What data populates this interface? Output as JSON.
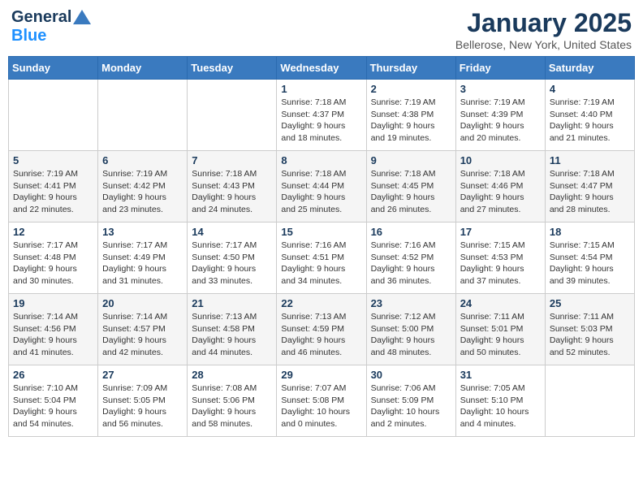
{
  "header": {
    "logo_general": "General",
    "logo_blue": "Blue",
    "month_title": "January 2025",
    "location": "Bellerose, New York, United States"
  },
  "weekdays": [
    "Sunday",
    "Monday",
    "Tuesday",
    "Wednesday",
    "Thursday",
    "Friday",
    "Saturday"
  ],
  "weeks": [
    [
      {
        "day": "",
        "info": ""
      },
      {
        "day": "",
        "info": ""
      },
      {
        "day": "",
        "info": ""
      },
      {
        "day": "1",
        "info": "Sunrise: 7:18 AM\nSunset: 4:37 PM\nDaylight: 9 hours\nand 18 minutes."
      },
      {
        "day": "2",
        "info": "Sunrise: 7:19 AM\nSunset: 4:38 PM\nDaylight: 9 hours\nand 19 minutes."
      },
      {
        "day": "3",
        "info": "Sunrise: 7:19 AM\nSunset: 4:39 PM\nDaylight: 9 hours\nand 20 minutes."
      },
      {
        "day": "4",
        "info": "Sunrise: 7:19 AM\nSunset: 4:40 PM\nDaylight: 9 hours\nand 21 minutes."
      }
    ],
    [
      {
        "day": "5",
        "info": "Sunrise: 7:19 AM\nSunset: 4:41 PM\nDaylight: 9 hours\nand 22 minutes."
      },
      {
        "day": "6",
        "info": "Sunrise: 7:19 AM\nSunset: 4:42 PM\nDaylight: 9 hours\nand 23 minutes."
      },
      {
        "day": "7",
        "info": "Sunrise: 7:18 AM\nSunset: 4:43 PM\nDaylight: 9 hours\nand 24 minutes."
      },
      {
        "day": "8",
        "info": "Sunrise: 7:18 AM\nSunset: 4:44 PM\nDaylight: 9 hours\nand 25 minutes."
      },
      {
        "day": "9",
        "info": "Sunrise: 7:18 AM\nSunset: 4:45 PM\nDaylight: 9 hours\nand 26 minutes."
      },
      {
        "day": "10",
        "info": "Sunrise: 7:18 AM\nSunset: 4:46 PM\nDaylight: 9 hours\nand 27 minutes."
      },
      {
        "day": "11",
        "info": "Sunrise: 7:18 AM\nSunset: 4:47 PM\nDaylight: 9 hours\nand 28 minutes."
      }
    ],
    [
      {
        "day": "12",
        "info": "Sunrise: 7:17 AM\nSunset: 4:48 PM\nDaylight: 9 hours\nand 30 minutes."
      },
      {
        "day": "13",
        "info": "Sunrise: 7:17 AM\nSunset: 4:49 PM\nDaylight: 9 hours\nand 31 minutes."
      },
      {
        "day": "14",
        "info": "Sunrise: 7:17 AM\nSunset: 4:50 PM\nDaylight: 9 hours\nand 33 minutes."
      },
      {
        "day": "15",
        "info": "Sunrise: 7:16 AM\nSunset: 4:51 PM\nDaylight: 9 hours\nand 34 minutes."
      },
      {
        "day": "16",
        "info": "Sunrise: 7:16 AM\nSunset: 4:52 PM\nDaylight: 9 hours\nand 36 minutes."
      },
      {
        "day": "17",
        "info": "Sunrise: 7:15 AM\nSunset: 4:53 PM\nDaylight: 9 hours\nand 37 minutes."
      },
      {
        "day": "18",
        "info": "Sunrise: 7:15 AM\nSunset: 4:54 PM\nDaylight: 9 hours\nand 39 minutes."
      }
    ],
    [
      {
        "day": "19",
        "info": "Sunrise: 7:14 AM\nSunset: 4:56 PM\nDaylight: 9 hours\nand 41 minutes."
      },
      {
        "day": "20",
        "info": "Sunrise: 7:14 AM\nSunset: 4:57 PM\nDaylight: 9 hours\nand 42 minutes."
      },
      {
        "day": "21",
        "info": "Sunrise: 7:13 AM\nSunset: 4:58 PM\nDaylight: 9 hours\nand 44 minutes."
      },
      {
        "day": "22",
        "info": "Sunrise: 7:13 AM\nSunset: 4:59 PM\nDaylight: 9 hours\nand 46 minutes."
      },
      {
        "day": "23",
        "info": "Sunrise: 7:12 AM\nSunset: 5:00 PM\nDaylight: 9 hours\nand 48 minutes."
      },
      {
        "day": "24",
        "info": "Sunrise: 7:11 AM\nSunset: 5:01 PM\nDaylight: 9 hours\nand 50 minutes."
      },
      {
        "day": "25",
        "info": "Sunrise: 7:11 AM\nSunset: 5:03 PM\nDaylight: 9 hours\nand 52 minutes."
      }
    ],
    [
      {
        "day": "26",
        "info": "Sunrise: 7:10 AM\nSunset: 5:04 PM\nDaylight: 9 hours\nand 54 minutes."
      },
      {
        "day": "27",
        "info": "Sunrise: 7:09 AM\nSunset: 5:05 PM\nDaylight: 9 hours\nand 56 minutes."
      },
      {
        "day": "28",
        "info": "Sunrise: 7:08 AM\nSunset: 5:06 PM\nDaylight: 9 hours\nand 58 minutes."
      },
      {
        "day": "29",
        "info": "Sunrise: 7:07 AM\nSunset: 5:08 PM\nDaylight: 10 hours\nand 0 minutes."
      },
      {
        "day": "30",
        "info": "Sunrise: 7:06 AM\nSunset: 5:09 PM\nDaylight: 10 hours\nand 2 minutes."
      },
      {
        "day": "31",
        "info": "Sunrise: 7:05 AM\nSunset: 5:10 PM\nDaylight: 10 hours\nand 4 minutes."
      },
      {
        "day": "",
        "info": ""
      }
    ]
  ]
}
